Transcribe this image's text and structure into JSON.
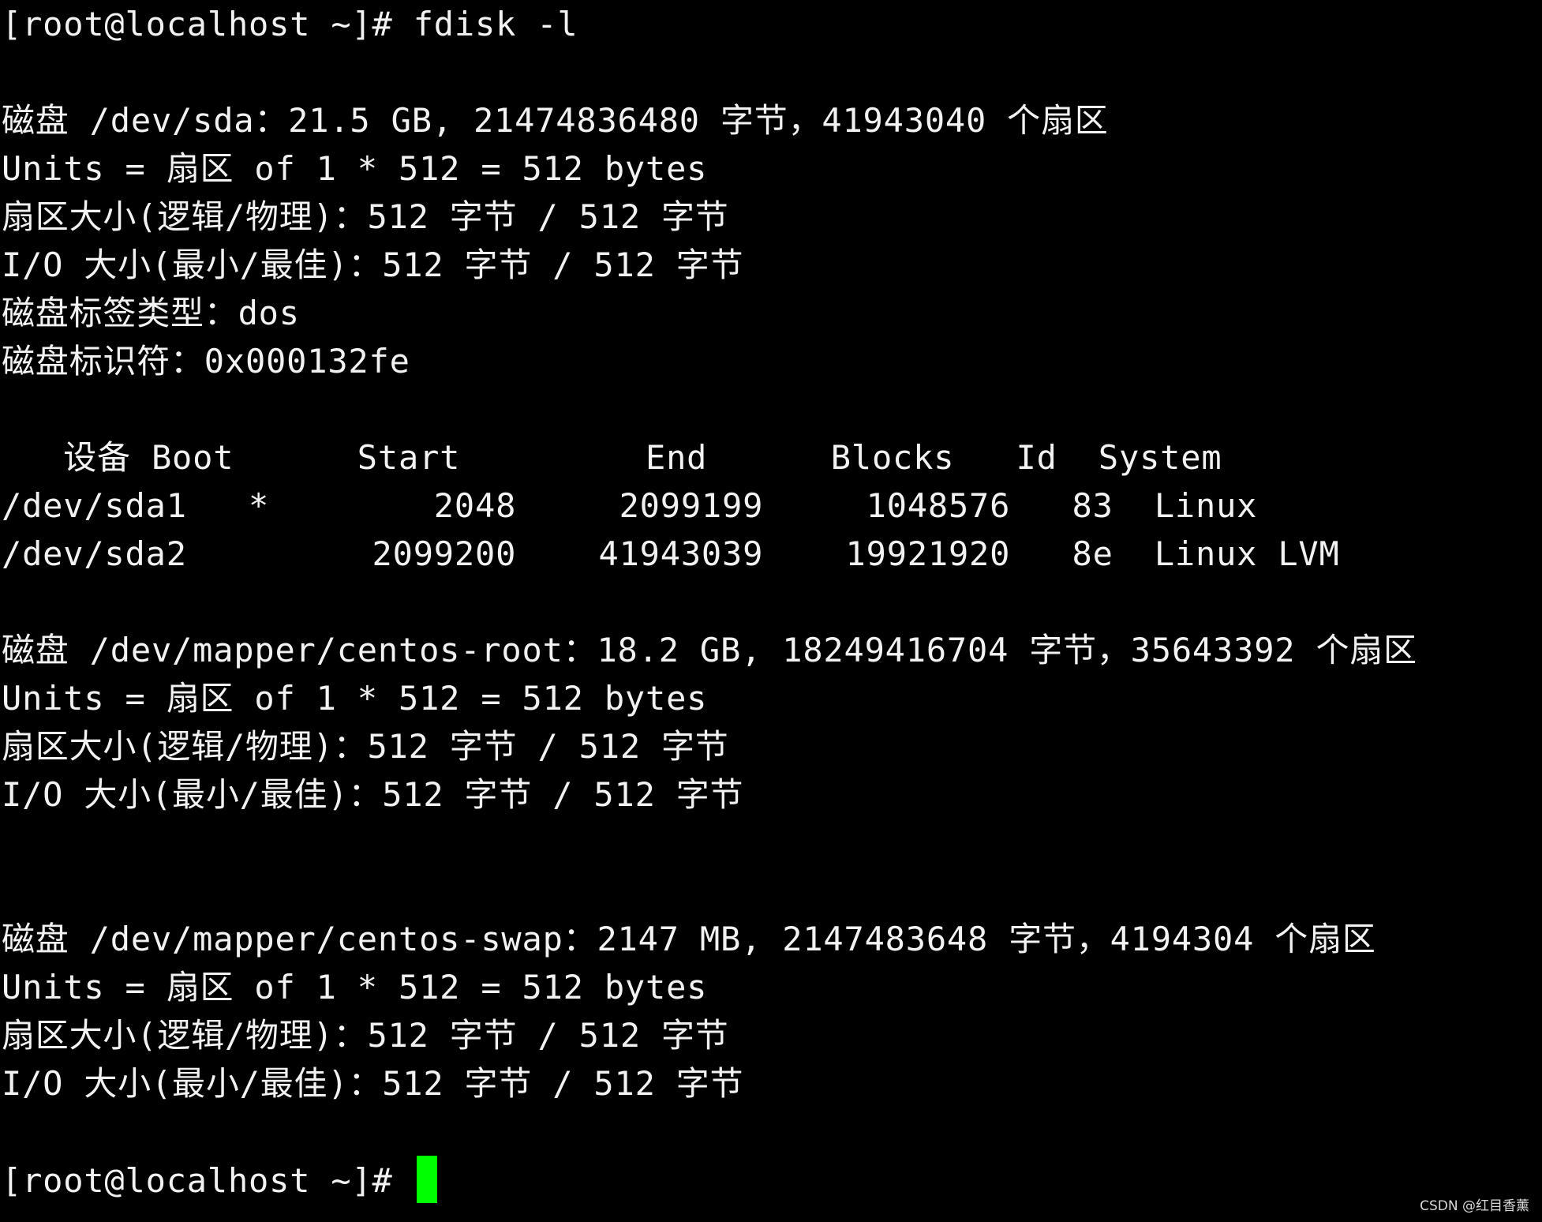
{
  "terminal": {
    "background": "#000000",
    "foreground": "#f2f2f2",
    "cursor_color": "#00ff00",
    "lines": [
      "[root@localhost ~]# fdisk -l",
      "",
      "磁盘 /dev/sda：21.5 GB, 21474836480 字节，41943040 个扇区",
      "Units = 扇区 of 1 * 512 = 512 bytes",
      "扇区大小(逻辑/物理)：512 字节 / 512 字节",
      "I/O 大小(最小/最佳)：512 字节 / 512 字节",
      "磁盘标签类型：dos",
      "磁盘标识符：0x000132fe",
      "",
      "   设备 Boot      Start         End      Blocks   Id  System",
      "/dev/sda1   *        2048     2099199     1048576   83  Linux",
      "/dev/sda2         2099200    41943039    19921920   8e  Linux LVM",
      "",
      "磁盘 /dev/mapper/centos-root：18.2 GB, 18249416704 字节，35643392 个扇区",
      "Units = 扇区 of 1 * 512 = 512 bytes",
      "扇区大小(逻辑/物理)：512 字节 / 512 字节",
      "I/O 大小(最小/最佳)：512 字节 / 512 字节",
      "",
      "",
      "磁盘 /dev/mapper/centos-swap：2147 MB, 2147483648 字节，4194304 个扇区",
      "Units = 扇区 of 1 * 512 = 512 bytes",
      "扇区大小(逻辑/物理)：512 字节 / 512 字节",
      "I/O 大小(最小/最佳)：512 字节 / 512 字节",
      ""
    ],
    "prompt": "[root@localhost ~]# "
  },
  "watermark": "CSDN @红目香薰"
}
